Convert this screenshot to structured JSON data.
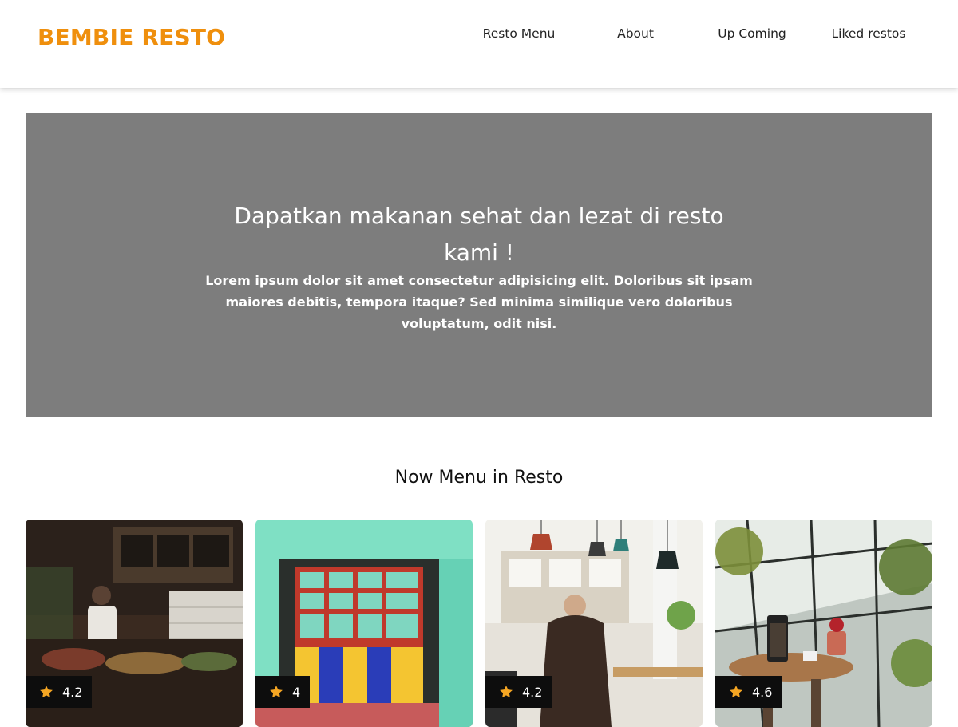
{
  "header": {
    "brand": "BEMBIE RESTO",
    "nav": [
      {
        "label": "Resto Menu"
      },
      {
        "label": "About"
      },
      {
        "label": "Up Coming"
      },
      {
        "label": "Liked restos"
      }
    ]
  },
  "hero": {
    "title": "Dapatkan makanan sehat dan lezat di resto kami !",
    "text": "Lorem ipsum dolor sit amet consectetur adipisicing elit. Doloribus sit ipsam maiores debitis, tempora itaque? Sed minima similique vero doloribus voluptatum, odit nisi."
  },
  "section": {
    "title": "Now Menu in Resto"
  },
  "restaurants": [
    {
      "rating": "4.2",
      "icon": "star-icon"
    },
    {
      "rating": "4",
      "icon": "star-icon"
    },
    {
      "rating": "4.2",
      "icon": "star-icon"
    },
    {
      "rating": "4.6",
      "icon": "star-icon"
    }
  ],
  "colors": {
    "brand": "#ef8f0d",
    "hero_bg": "#7d7d7d",
    "star": "#f5a623"
  }
}
